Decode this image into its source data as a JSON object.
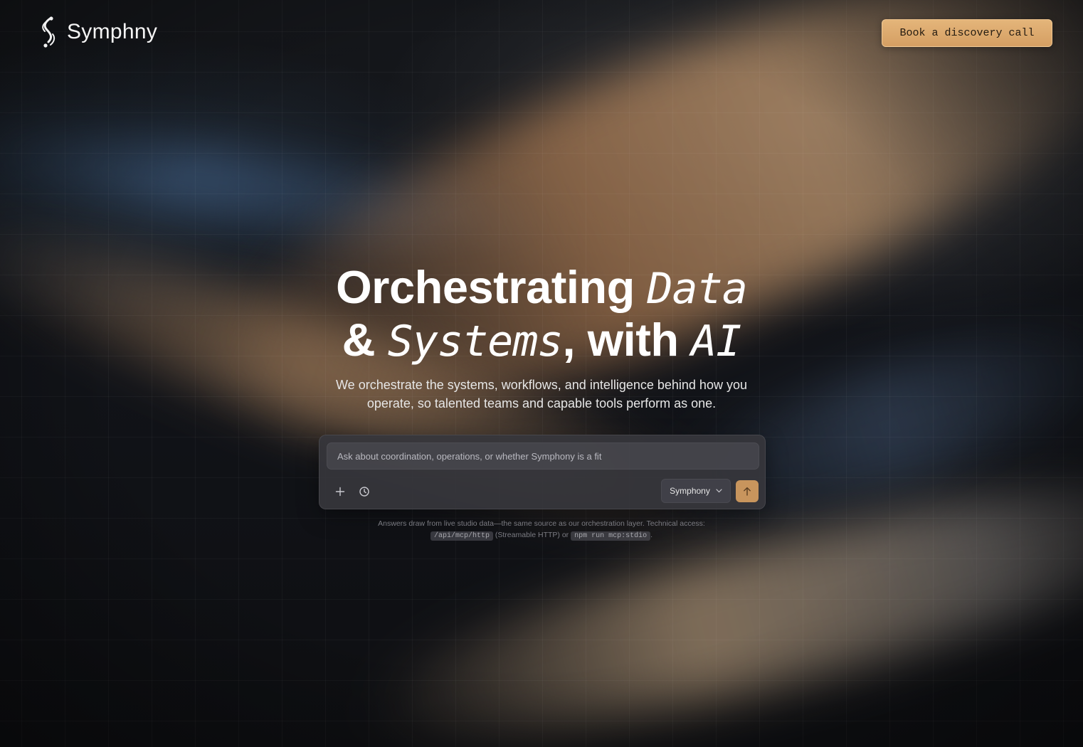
{
  "brand": {
    "name": "Symphny",
    "logo_icon": "s-swirl-logo-icon"
  },
  "header": {
    "cta_label": "Book a discovery call"
  },
  "hero": {
    "title_part1": "Orchestrating ",
    "title_italic1": "Data",
    "title_part2": "& ",
    "title_italic2": "Systems",
    "title_part3": ", with ",
    "title_italic3": "AI",
    "subtitle": "We orchestrate the systems, workflows, and intelligence behind how you operate, so talented teams and capable tools perform as one."
  },
  "composer": {
    "placeholder": "Ask about coordination, operations, or whether Symphony is a fit",
    "value": "",
    "attach_icon": "plus-icon",
    "history_icon": "clock-icon",
    "model_selected": "Symphony",
    "model_icon": "chevron-down-icon",
    "send_icon": "arrow-up-icon"
  },
  "footnote": {
    "text1": "Answers draw from live studio data—the same source as our orchestration layer. Technical access:",
    "code1": "/api/mcp/http",
    "text2": "(Streamable HTTP) or",
    "code2": "npm run mcp:stdio",
    "text3": "."
  },
  "colors": {
    "accent": "#d9a86c",
    "background": "#111318",
    "panel": "#36363c"
  }
}
